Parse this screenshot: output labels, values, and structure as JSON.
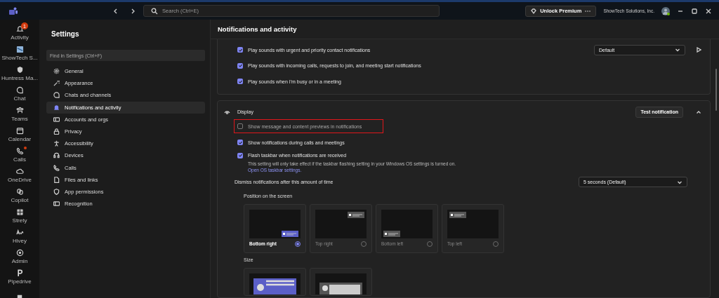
{
  "title_bar": {
    "search_placeholder": "Search (Ctrl+E)",
    "premium_button": "Unlock Premium",
    "org": "ShowTech Solutions, Inc."
  },
  "rail": [
    {
      "label": "Activity",
      "badge": "1",
      "alert": false
    },
    {
      "label": "ShowTech S...",
      "alert": false
    },
    {
      "label": "Huntress Ma...",
      "alert": false
    },
    {
      "label": "Chat",
      "alert": false
    },
    {
      "label": "Teams",
      "alert": false
    },
    {
      "label": "Calendar",
      "alert": false
    },
    {
      "label": "Calls",
      "alert": true
    },
    {
      "label": "OneDrive",
      "alert": false
    },
    {
      "label": "Copilot",
      "alert": false
    },
    {
      "label": "Strety",
      "alert": false
    },
    {
      "label": "Hivey",
      "alert": false
    },
    {
      "label": "Admin",
      "alert": false
    },
    {
      "label": "Pipedrive",
      "alert": false
    },
    {
      "alert": false
    }
  ],
  "settings": {
    "title": "Settings",
    "search_placeholder": "Find in Settings (Ctrl+F)",
    "items": [
      {
        "label": "General",
        "selected": false
      },
      {
        "label": "Appearance",
        "selected": false
      },
      {
        "label": "Chats and channels",
        "selected": false
      },
      {
        "label": "Notifications and activity",
        "selected": true
      },
      {
        "label": "Accounts and orgs",
        "selected": false
      },
      {
        "label": "Privacy",
        "selected": false
      },
      {
        "label": "Accessibility",
        "selected": false
      },
      {
        "label": "Devices",
        "selected": false
      },
      {
        "label": "Calls",
        "selected": false
      },
      {
        "label": "Files and links",
        "selected": false
      },
      {
        "label": "App permissions",
        "selected": false
      },
      {
        "label": "Recognition",
        "selected": false
      }
    ]
  },
  "page": {
    "title": "Notifications and activity",
    "sound_dropdown": "Default",
    "sound_options": [
      {
        "label": "Play sounds with urgent and priority contact notifications",
        "checked": true
      },
      {
        "label": "Play sounds with incoming calls, requests to join, and meeting start notifications",
        "checked": true
      },
      {
        "label": "Play sounds when I'm busy or in a meeting",
        "checked": true
      }
    ],
    "display": {
      "title": "Display",
      "test_button": "Test notification",
      "expanded": true,
      "options": [
        {
          "label": "Show message and content previews in notifications",
          "checked": false,
          "highlighted": true
        },
        {
          "label": "Show notifications during calls and meetings",
          "checked": true,
          "highlighted": false
        },
        {
          "label": "Flash taskbar when notifications are received",
          "checked": true,
          "highlighted": false,
          "note": "This setting will only take effect if the taskbar flashing setting in your Windows OS settings is turned on.",
          "link": "Open OS taskbar settings."
        }
      ],
      "dismiss_label": "Dismiss notifications after this amount of time",
      "dismiss_value": "5 seconds (Default)",
      "position_label": "Position on the screen",
      "positions": [
        {
          "label": "Bottom right",
          "selected": true,
          "kind": "bottom-right"
        },
        {
          "label": "Top right",
          "selected": false,
          "kind": "top-right"
        },
        {
          "label": "Bottom left",
          "selected": false,
          "kind": "bottom-left"
        },
        {
          "label": "Top left",
          "selected": false,
          "kind": "top-left"
        }
      ],
      "size_label": "Size",
      "sizes": [
        {
          "selected": true
        },
        {
          "selected": false
        }
      ]
    }
  }
}
